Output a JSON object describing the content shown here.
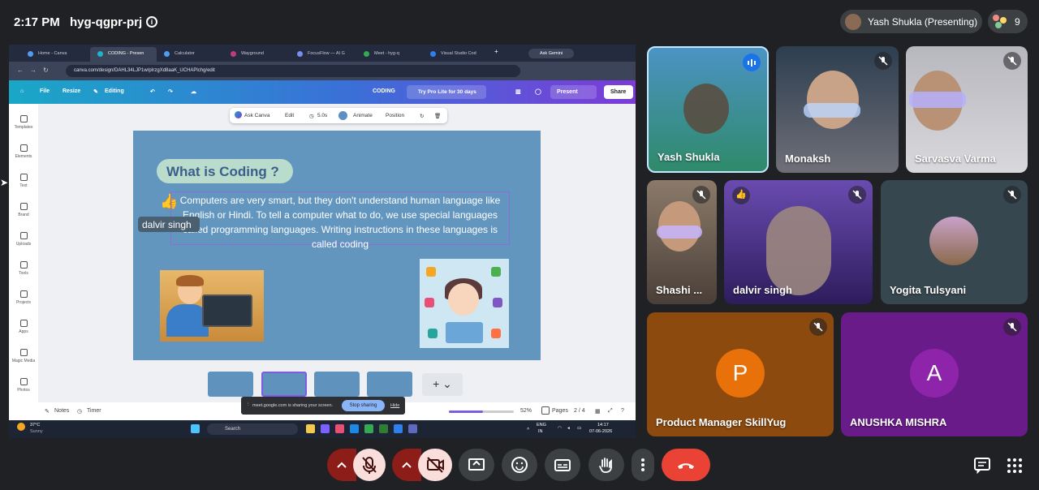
{
  "meet": {
    "time": "2:17 PM",
    "meeting_code": "hyg-qgpr-prj",
    "presenter_label": "Yash Shukla (Presenting)",
    "participant_count": "9"
  },
  "browser": {
    "tabs": [
      {
        "label": "Home - Canva",
        "color": "#4f9cf0"
      },
      {
        "label": "CODING - Presen",
        "color": "#20b3c9"
      },
      {
        "label": "Calculator",
        "color": "#4f9cf0"
      },
      {
        "label": "Wayground",
        "color": "#c03a7f"
      },
      {
        "label": "FocusFlow — AI G",
        "color": "#7a8cf0"
      },
      {
        "label": "Meet - hyg-q",
        "color": "#34a853"
      },
      {
        "label": "Visual Studio Cod",
        "color": "#2f80ed"
      }
    ],
    "ask_gemini": "Ask Gemini",
    "url": "canva.com/design/DAHL34LJP1w/pIrzgXd8aaK_UCHAPlchg/edit"
  },
  "canva": {
    "menu": {
      "file": "File",
      "resize": "Resize",
      "editing": "Editing"
    },
    "doc_title": "CODING",
    "try_pro": "Try Pro Lite for 30 days",
    "present": "Present",
    "share": "Share",
    "rail": [
      "Templates",
      "Elements",
      "Text",
      "Brand",
      "Uploads",
      "Tools",
      "Projects",
      "Apps",
      "Magic Media",
      "Photos"
    ],
    "float_toolbar": {
      "ask_canva": "Ask Canva",
      "edit": "Edit",
      "duration": "5.0s",
      "animate": "Animate",
      "position": "Position"
    },
    "slide": {
      "title": "What is Coding ?",
      "body": "Computers are very smart, but they don't understand human language like English or Hindi. To tell a computer what to do, we use special languages called programming languages. Writing instructions in these languages is called coding",
      "cursor_label": "dalvir singh"
    },
    "bottom": {
      "notes": "Notes",
      "timer": "Timer",
      "zoom": "52%",
      "pages_label": "Pages",
      "pages_count": "2 / 4"
    },
    "zoom_fraction": 0.52
  },
  "share_notice": {
    "text": "meet.google.com is sharing your screen.",
    "stop": "Stop sharing",
    "hide": "Hide"
  },
  "taskbar": {
    "weather_temp": "37°C",
    "weather_desc": "Sunny",
    "search": "Search",
    "lang": "ENG",
    "region": "IN",
    "clock_time": "14:17",
    "clock_date": "07-06-2026"
  },
  "participants": [
    {
      "name": "Yash Shukla",
      "speaking": true
    },
    {
      "name": "Monaksh",
      "muted": true
    },
    {
      "name": "Sarvasva Varma",
      "muted": true
    },
    {
      "name": "Shashi ...",
      "muted": true
    },
    {
      "name": "dalvir singh",
      "muted": true
    },
    {
      "name": "Yogita Tulsyani",
      "muted": true
    },
    {
      "name": "Product Manager SkillYug",
      "initial": "P",
      "color": "#e8710a",
      "muted": true
    },
    {
      "name": "ANUSHKA MISHRA",
      "initial": "A",
      "color": "#8e24aa",
      "muted": true
    }
  ]
}
